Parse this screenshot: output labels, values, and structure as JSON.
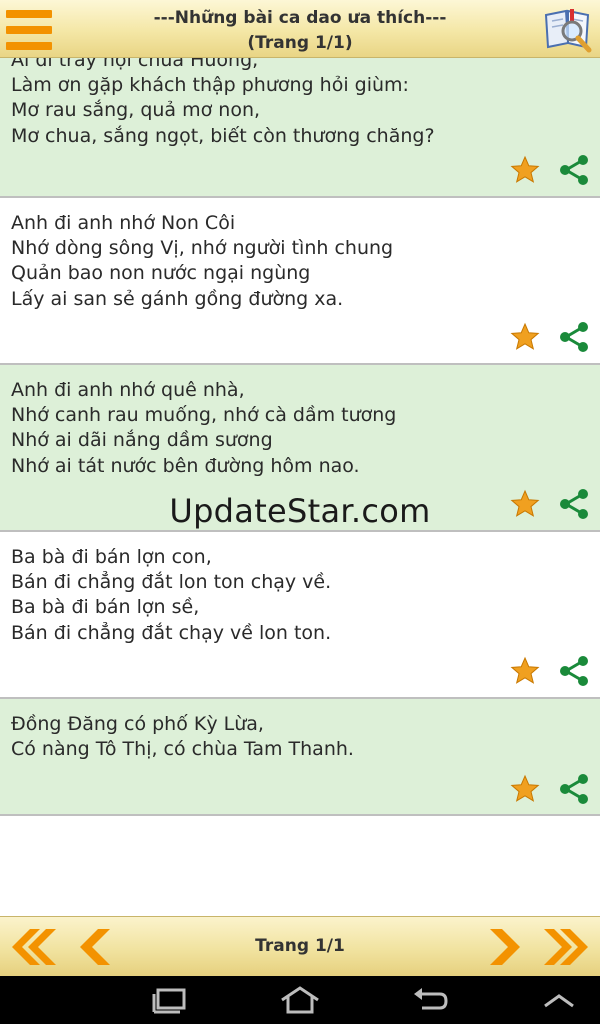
{
  "header": {
    "title_line1": "---Những bài ca dao ưa thích---",
    "title_line2": "(Trang 1/1)"
  },
  "verses": [
    {
      "lines": [
        "Ai đi trẩy hội chùa Hương,",
        "Làm ơn gặp khách thập phương hỏi giùm:",
        "Mơ rau sắng, quả mơ non,",
        "Mơ chua, sắng ngọt, biết còn thương chăng?"
      ]
    },
    {
      "lines": [
        "Anh đi anh nhớ Non Côi",
        "Nhớ dòng sông Vị, nhớ người tình chung",
        "Quản bao non nước ngại ngùng",
        "Lấy ai san sẻ gánh gồng đường xa."
      ]
    },
    {
      "lines": [
        "Anh đi anh nhớ quê nhà,",
        "Nhớ canh rau muống, nhớ cà dầm tương",
        "Nhớ ai dãi nắng dầm sương",
        "Nhớ ai tát nước bên đường hôm nao."
      ]
    },
    {
      "lines": [
        "Ba bà đi bán lợn con,",
        "Bán đi chẳng đắt lon ton chạy về.",
        "Ba bà đi bán lợn sề,",
        "Bán đi chẳng đắt chạy về lon ton."
      ]
    },
    {
      "lines": [
        "Đồng Đăng có phố Kỳ Lừa,",
        "Có nàng Tô Thị, có chùa Tam Thanh."
      ]
    }
  ],
  "watermark": "UpdateStar.com",
  "footer": {
    "page_label": "Trang 1/1"
  },
  "icons": {
    "menu": "menu-icon",
    "book_search": "book-search-icon",
    "star": "star-icon",
    "share": "share-icon",
    "first_page": "double-chevron-left-icon",
    "prev_page": "chevron-left-icon",
    "next_page": "chevron-right-icon",
    "last_page": "double-chevron-right-icon"
  },
  "colors": {
    "accent_orange": "#f39200",
    "star_fill": "#f0a020",
    "share_green": "#1a8a3a",
    "item_green_bg": "#ddf0d8",
    "header_bg": "#f4e7a6"
  }
}
